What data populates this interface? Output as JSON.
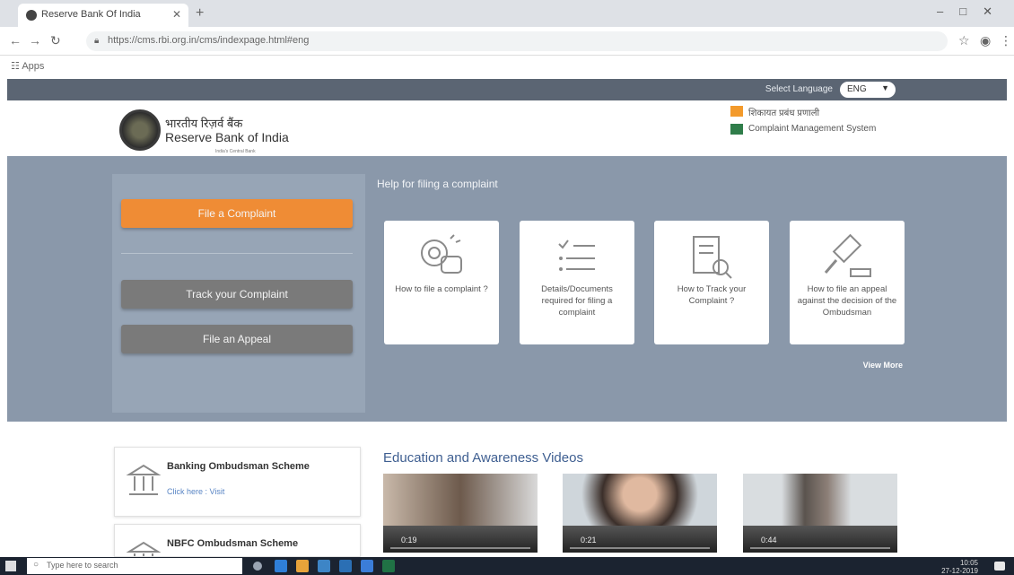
{
  "browser": {
    "tab_title": "Reserve Bank Of India",
    "url": "https://cms.rbi.org.in/cms/indexpage.html#eng",
    "bookmarks_label": "Apps"
  },
  "site": {
    "language_label": "Select Language",
    "language_value": "ENG",
    "brand_hindi": "भारतीय रिज़र्व बैंक",
    "brand_english": "Reserve Bank of India",
    "brand_sub": "India's Central Bank",
    "legend": [
      {
        "label": "शिकायत प्रबंध प्रणाली",
        "color": "#f39a2b"
      },
      {
        "label": "Complaint Management System",
        "color": "#2f7d4a"
      }
    ]
  },
  "actions": {
    "file_complaint": "File a Complaint",
    "track_complaint": "Track your Complaint",
    "file_appeal": "File an Appeal"
  },
  "help": {
    "title": "Help for filing a complaint",
    "cards": [
      {
        "label": "How to file a complaint ?",
        "icon": "chat-bubble-icon"
      },
      {
        "label": "Details/Documents required for filing a complaint",
        "icon": "checklist-icon"
      },
      {
        "label": "How to Track your Complaint ?",
        "icon": "document-search-icon"
      },
      {
        "label": "How to file an appeal against the decision of the Ombudsman",
        "icon": "gavel-icon"
      }
    ],
    "view_more": "View More"
  },
  "schemes": [
    {
      "title": "Banking Ombudsman Scheme",
      "link": "Click here : Visit",
      "icon": "bank-building-icon"
    },
    {
      "title": "NBFC Ombudsman Scheme",
      "link": "",
      "icon": "bank-building-icon"
    }
  ],
  "education": {
    "title": "Education and Awareness Videos",
    "videos": [
      {
        "time": "0:19"
      },
      {
        "time": "0:21"
      },
      {
        "time": "0:44"
      }
    ]
  },
  "taskbar": {
    "search_placeholder": "Type here to search",
    "time": "10:05",
    "date": "27-12-2019"
  }
}
